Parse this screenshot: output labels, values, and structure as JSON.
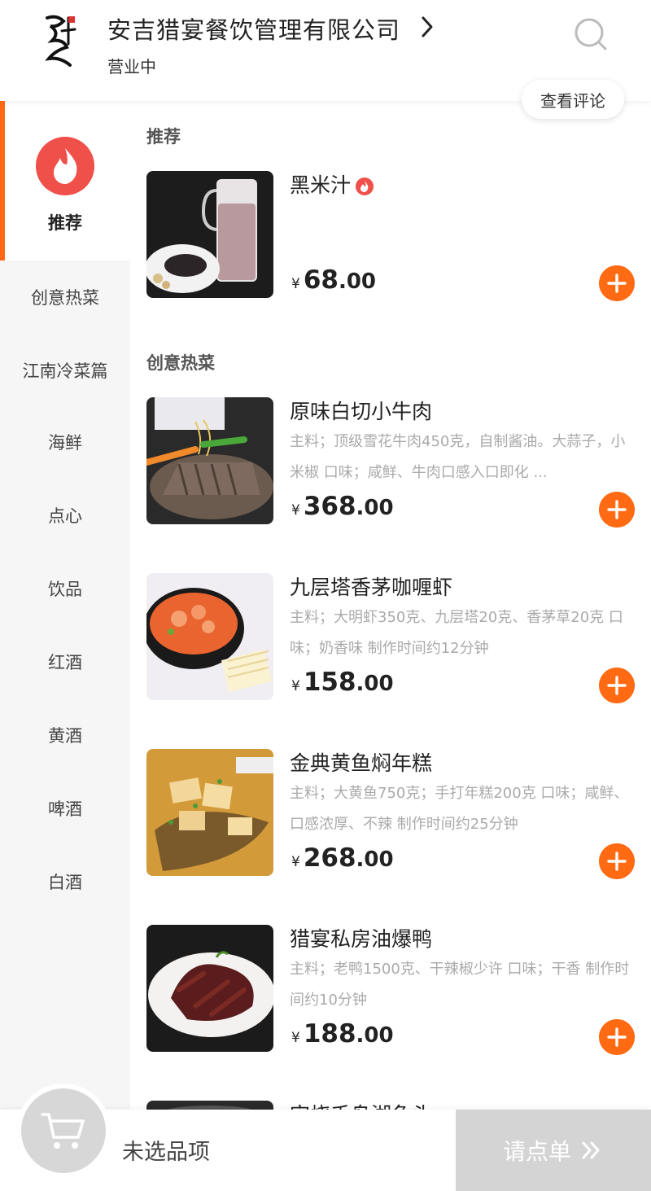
{
  "header": {
    "shop_name": "安吉猎宴餐饮管理有限公司",
    "status": "营业中",
    "review_button": "查看评论",
    "logo_icon": "calligraphy-logo-icon",
    "search_icon": "search-icon"
  },
  "sidebar": {
    "active": {
      "label": "推荐",
      "icon": "fire-icon"
    },
    "items": [
      {
        "label": "创意热菜"
      },
      {
        "label": "江南冷菜篇"
      },
      {
        "label": "海鲜"
      },
      {
        "label": "点心"
      },
      {
        "label": "饮品"
      },
      {
        "label": "红酒"
      },
      {
        "label": "黄酒"
      },
      {
        "label": "啤酒"
      },
      {
        "label": "白酒"
      }
    ]
  },
  "sections": [
    {
      "title": "推荐",
      "dishes": [
        {
          "name": "黑米汁",
          "desc": "",
          "currency": "¥",
          "price_int": "68",
          "price_dec": ".00",
          "hot": true
        }
      ]
    },
    {
      "title": "创意热菜",
      "dishes": [
        {
          "name": "原味白切小牛肉",
          "desc": "主料；顶级雪花牛肉450克，自制酱油。大蒜子，小米椒 口味；咸鲜、牛肉口感入口即化 ...",
          "currency": "¥",
          "price_int": "368",
          "price_dec": ".00"
        },
        {
          "name": "九层塔香茅咖喱虾",
          "desc": "主料；大明虾350克、九层塔20克、香茅草20克 口味；奶香味 制作时间约12分钟",
          "currency": "¥",
          "price_int": "158",
          "price_dec": ".00"
        },
        {
          "name": "金典黄鱼焖年糕",
          "desc": "主料；大黄鱼750克；手打年糕200克 口味；咸鲜、口感浓厚、不辣 制作时间约25分钟",
          "currency": "¥",
          "price_int": "268",
          "price_dec": ".00"
        },
        {
          "name": "猎宴私房油爆鸭",
          "desc": "主料；老鸭1500克、干辣椒少许 口味；干香 制作时间约10分钟",
          "currency": "¥",
          "price_int": "188",
          "price_dec": ".00"
        },
        {
          "name": "宋烧千岛湖鱼头",
          "desc": "",
          "currency": "",
          "price_int": "",
          "price_dec": ""
        }
      ]
    }
  ],
  "cart": {
    "empty_text": "未选品项",
    "order_button": "请点单",
    "cart_icon": "cart-icon",
    "arrow_icon": "double-chevron-right-icon"
  },
  "colors": {
    "accent": "#ff6a13",
    "hot_red": "#f0504a",
    "sidebar_bg": "#f6f6f6",
    "disabled_gray": "#d4d4d4"
  }
}
